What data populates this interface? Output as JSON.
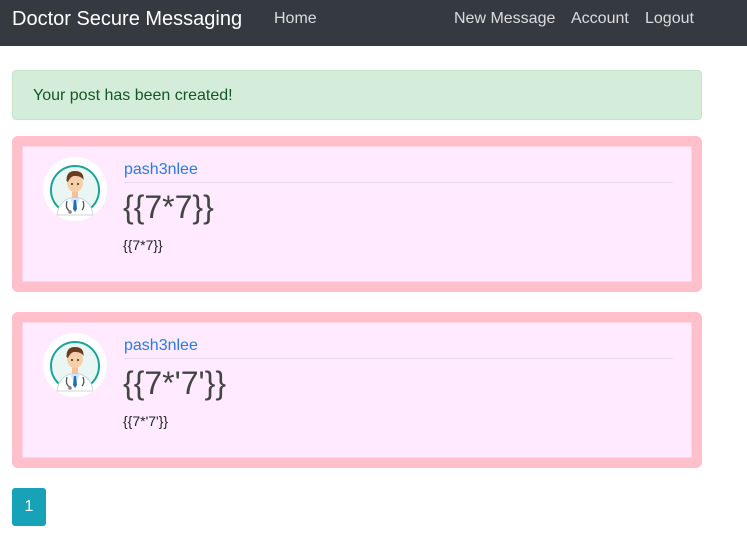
{
  "navbar": {
    "brand": "Doctor Secure Messaging",
    "home": "Home",
    "new_message": "New Message",
    "account": "Account",
    "logout": "Logout"
  },
  "alert": {
    "message": "Your post has been created!"
  },
  "posts": [
    {
      "author": "pash3nlee",
      "title": "{{7*7}}",
      "body": "{{7*7}}"
    },
    {
      "author": "pash3nlee",
      "title": "{{7*'7'}}",
      "body": "{{7*'7'}}"
    }
  ],
  "pagination": {
    "current_page": "1"
  },
  "colors": {
    "navbar_bg": "#343a40",
    "alert_success_bg": "#d4edda",
    "post_border": "#ffc0cb",
    "post_bg": "#ffeaff",
    "link": "#2a7ae2",
    "pagination_active": "#17a2b8"
  },
  "icons": {
    "avatar": "doctor-avatar-icon"
  }
}
